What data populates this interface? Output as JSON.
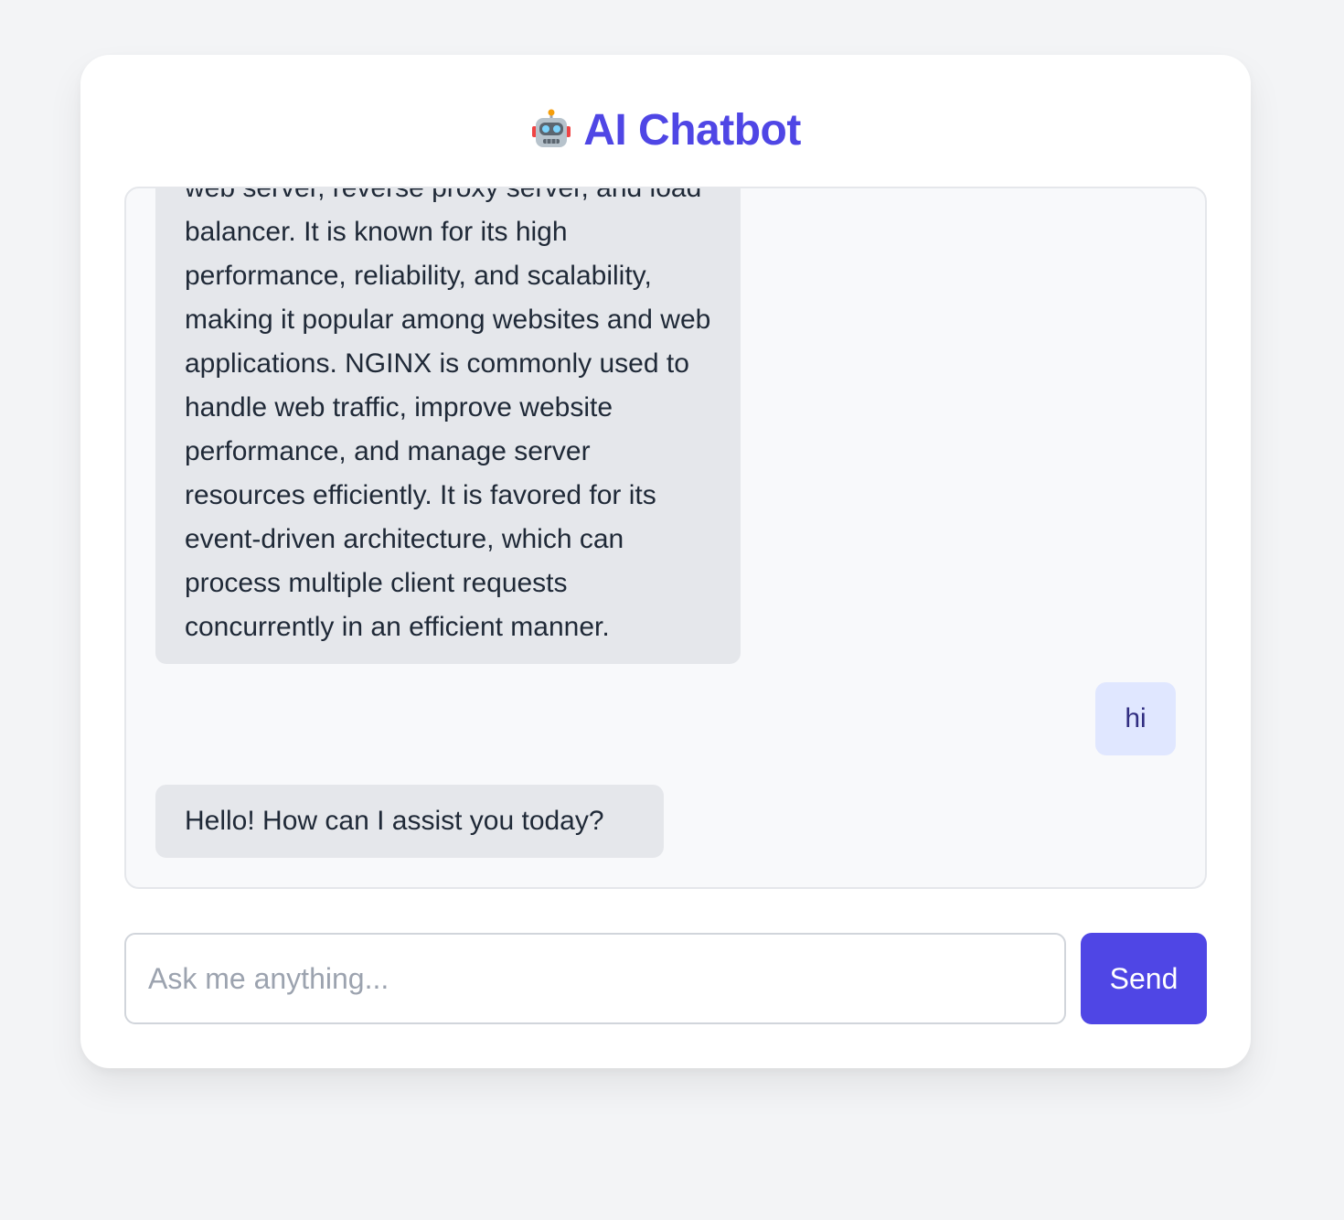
{
  "app": {
    "title": "AI Chatbot",
    "title_icon": "robot-icon",
    "accent_color": "#4f46e5"
  },
  "messages": [
    {
      "role": "bot",
      "text": "NGINX is a high-performance open-source web server, reverse proxy server, and load balancer. It is known for its high performance, reliability, and scalability, making it popular among websites and web applications. NGINX is commonly used to handle web traffic, improve website performance, and manage server resources efficiently. It is favored for its event-driven architecture, which can process multiple client requests concurrently in an efficient manner."
    },
    {
      "role": "user",
      "text": "hi"
    },
    {
      "role": "bot",
      "text": "Hello! How can I assist you today?"
    }
  ],
  "input": {
    "placeholder": "Ask me anything...",
    "value": ""
  },
  "send_button": {
    "label": "Send"
  }
}
